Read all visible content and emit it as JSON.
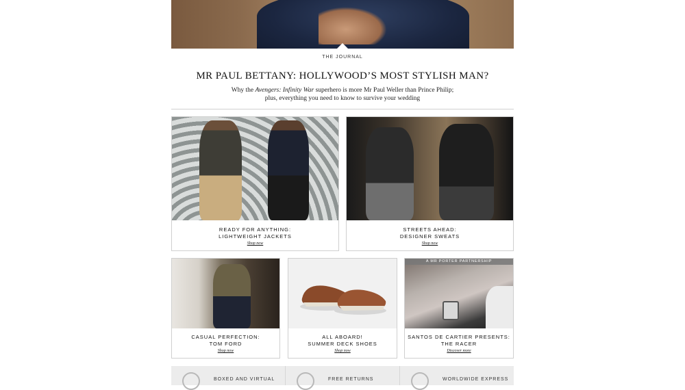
{
  "journal": {
    "kicker": "THE JOURNAL",
    "headline": "MR PAUL BETTANY: HOLLYWOOD’S MOST STYLISH MAN?",
    "standfirst_pre": "Why the ",
    "standfirst_em": "Avengers: Infinity War",
    "standfirst_post": " superhero is more Mr Paul Weller than Prince Philip;",
    "standfirst_line2": "plus, everything you need to know to survive your wedding"
  },
  "cards": [
    {
      "line1": "READY FOR ANYTHING:",
      "line2": "LIGHTWEIGHT JACKETS",
      "link": "Shop now"
    },
    {
      "line1": "STREETS AHEAD:",
      "line2": "DESIGNER SWEATS",
      "link": "Shop now"
    },
    {
      "line1": "CASUAL PERFECTION:",
      "line2": "TOM FORD",
      "link": "Shop now"
    },
    {
      "line1": "ALL ABOARD!",
      "line2": "SUMMER DECK SHOES",
      "link": "Shop now"
    },
    {
      "line1": "SANTOS DE CARTIER PRESENTS:",
      "line2": "THE RACER",
      "link": "Discover more",
      "tag": "A MR PORTER PARTNERSHIP"
    }
  ],
  "services": [
    {
      "label": "BOXED AND VIRTUAL",
      "icon": "gift-icon"
    },
    {
      "label": "FREE RETURNS",
      "icon": "returns-icon"
    },
    {
      "label": "WORLDWIDE EXPRESS",
      "icon": "express-icon"
    }
  ]
}
